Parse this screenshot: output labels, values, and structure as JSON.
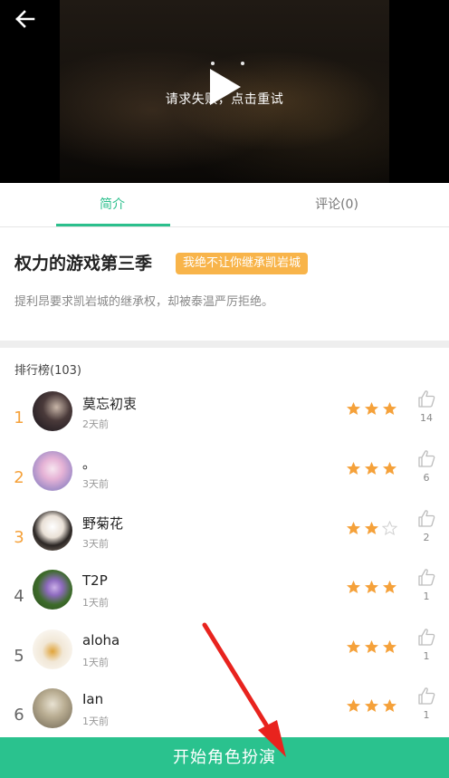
{
  "video": {
    "error_text": "请求失败，点击重试"
  },
  "tabs": [
    {
      "label": "简介"
    },
    {
      "label": "评论(0)"
    }
  ],
  "story": {
    "title": "权力的游戏第三季",
    "tag": "我绝不让你继承凯岩城",
    "description": "提利昂要求凯岩城的继承权，却被泰温严厉拒绝。"
  },
  "ranking": {
    "header": "排行榜(103)",
    "rows": [
      {
        "rank": "1",
        "name": "莫忘初衷",
        "time": "2天前",
        "stars": 3,
        "likes": "14",
        "rank_color": "#f5a13a"
      },
      {
        "rank": "2",
        "name": "。",
        "time": "3天前",
        "stars": 3,
        "likes": "6",
        "rank_color": "#f5a13a"
      },
      {
        "rank": "3",
        "name": "野菊花",
        "time": "3天前",
        "stars": 2,
        "likes": "2",
        "rank_color": "#f5a13a"
      },
      {
        "rank": "4",
        "name": "T2P",
        "time": "1天前",
        "stars": 3,
        "likes": "1",
        "rank_color": "#666666"
      },
      {
        "rank": "5",
        "name": "aloha",
        "time": "1天前",
        "stars": 3,
        "likes": "1",
        "rank_color": "#666666"
      },
      {
        "rank": "6",
        "name": "Ian",
        "time": "1天前",
        "stars": 3,
        "likes": "1",
        "rank_color": "#666666"
      }
    ]
  },
  "bottom": {
    "start_label": "开始角色扮演"
  },
  "colors": {
    "accent": "#2bbf8c",
    "star": "#f5a13a",
    "tag": "#f8b44a",
    "annotation_arrow": "#e8231e"
  },
  "icons": {
    "back": "arrow-left-icon",
    "play": "play-icon",
    "star": "star-icon",
    "like": "thumbs-up-icon"
  }
}
